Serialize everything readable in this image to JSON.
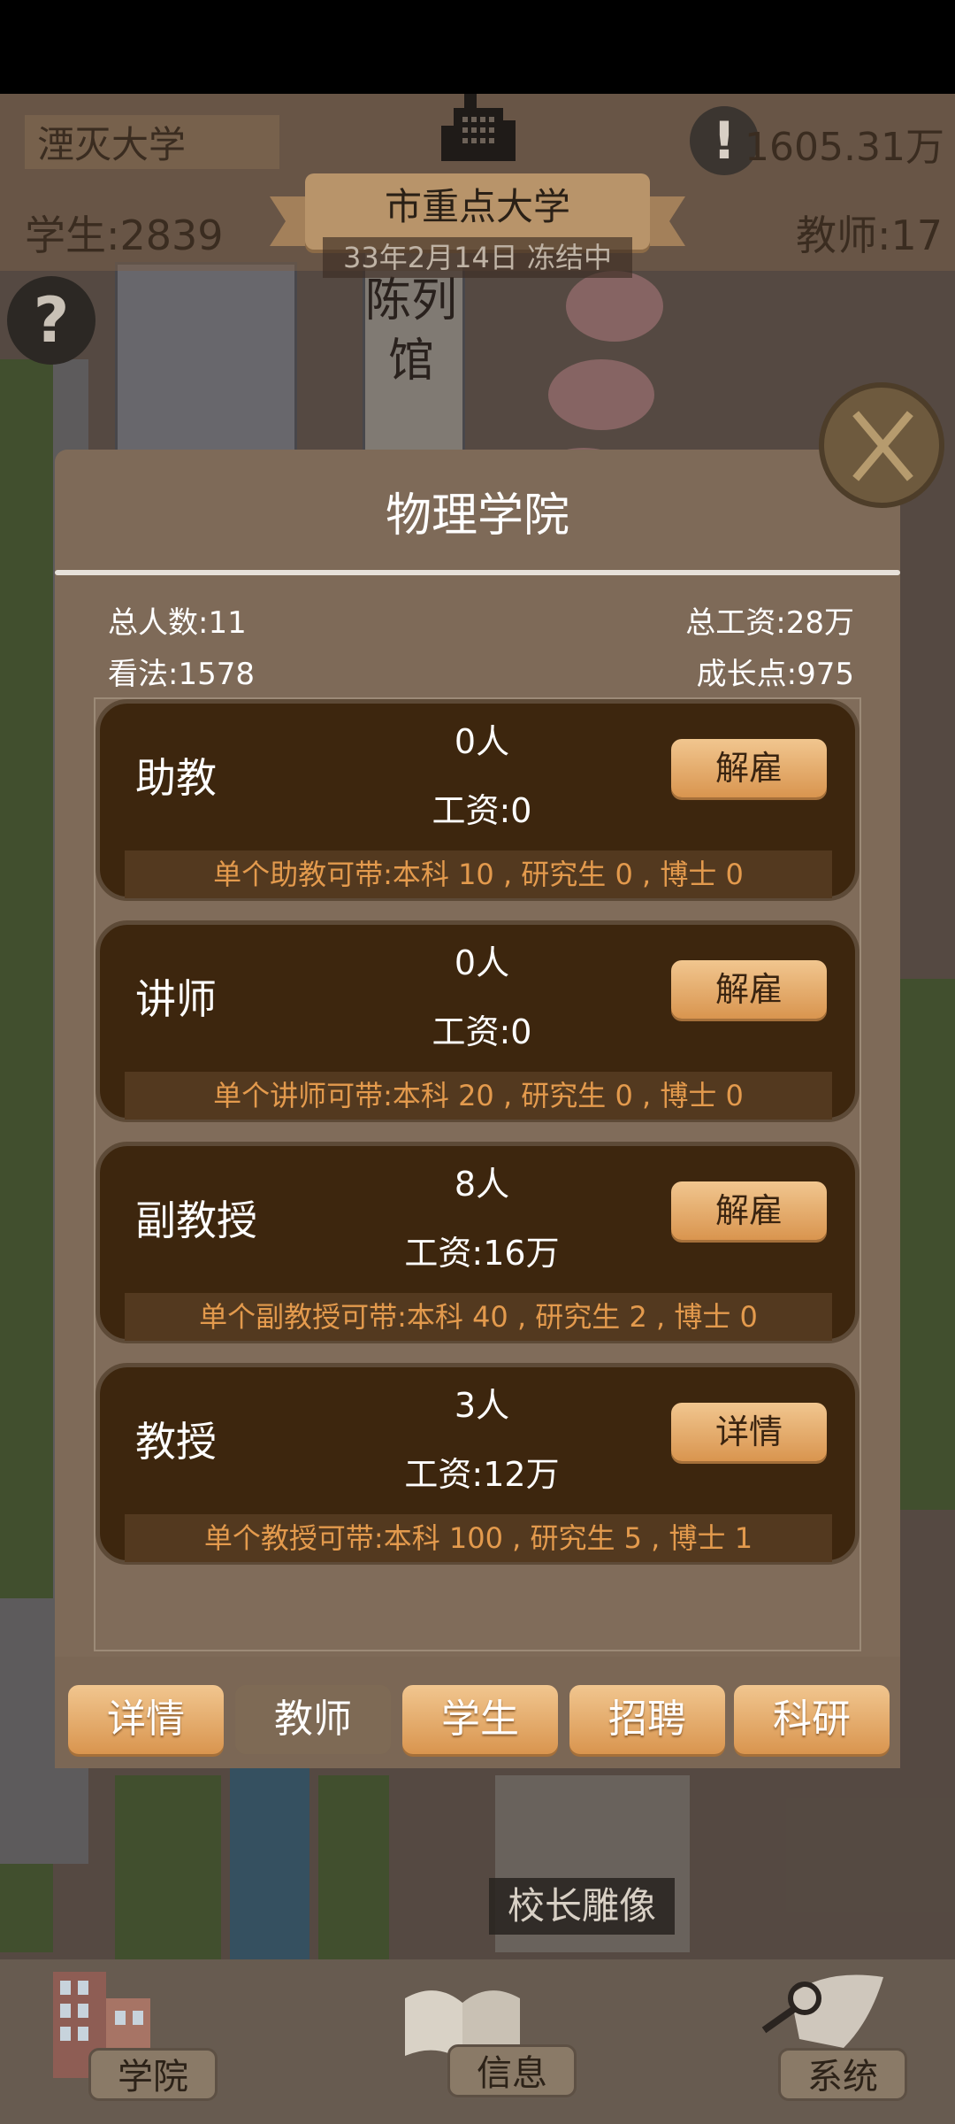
{
  "hud": {
    "school_name": "湮灭大学",
    "money": "1605.31万",
    "alert_symbol": "!",
    "students": "学生:2839",
    "teachers": "教师:17",
    "rank": "市重点大学",
    "date_status": "33年2月14日 冻结中",
    "help_symbol": "?"
  },
  "map": {
    "exhibit_hall": "陈列馆",
    "statue": "校长雕像"
  },
  "panel": {
    "title": "物理学院",
    "stats": {
      "total_people": "总人数:11",
      "total_salary": "总工资:28万",
      "opinion": "看法:1578",
      "growth_points": "成长点:975"
    },
    "cards": [
      {
        "role": "助教",
        "count": "0人",
        "salary": "工资:0",
        "button": "解雇",
        "capacity": "单个助教可带:本科 10 , 研究生 0 , 博士 0"
      },
      {
        "role": "讲师",
        "count": "0人",
        "salary": "工资:0",
        "button": "解雇",
        "capacity": "单个讲师可带:本科 20 , 研究生 0 , 博士 0"
      },
      {
        "role": "副教授",
        "count": "8人",
        "salary": "工资:16万",
        "button": "解雇",
        "capacity": "单个副教授可带:本科 40 , 研究生 2 , 博士 0"
      },
      {
        "role": "教授",
        "count": "3人",
        "salary": "工资:12万",
        "button": "详情",
        "capacity": "单个教授可带:本科 100 , 研究生 5 , 博士 1"
      }
    ],
    "tabs": [
      "详情",
      "教师",
      "学生",
      "招聘",
      "科研"
    ],
    "active_tab": "教师"
  },
  "bottom_nav": {
    "college": "学院",
    "info": "信息",
    "system": "系统"
  },
  "colors": {
    "card_bg": "#3d260e",
    "button_gradient_top": "#f1c68f",
    "button_gradient_bottom": "#d9954f",
    "capacity_text": "#e39a4d",
    "panel_bg": "#7e6a58"
  }
}
